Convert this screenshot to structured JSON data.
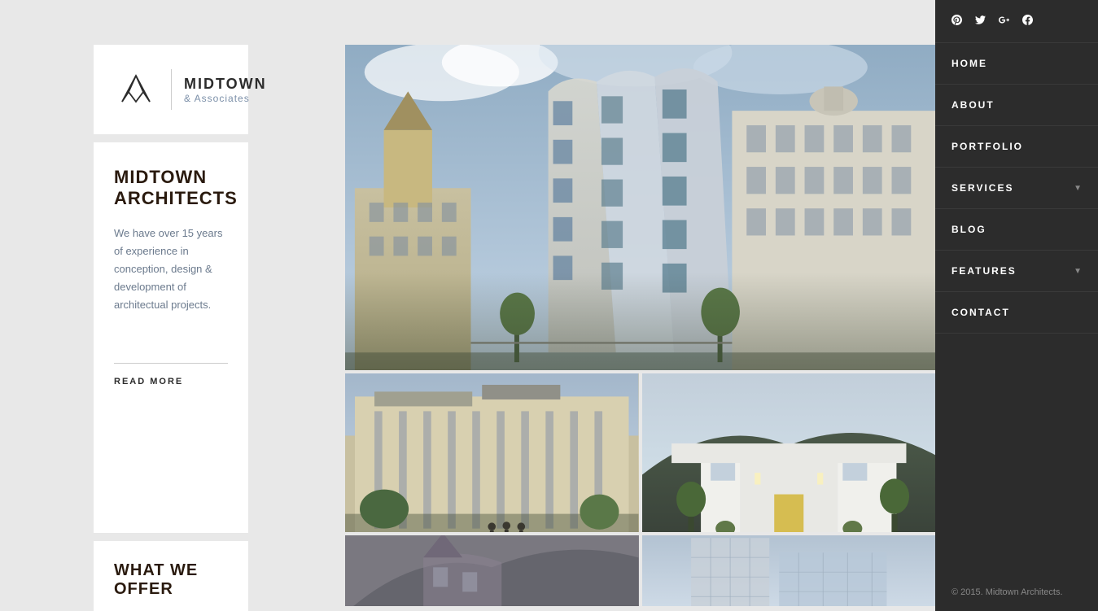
{
  "logo": {
    "title": "MIDTOWN",
    "subtitle": "& Associates"
  },
  "info": {
    "heading_line1": "MIDTOWN",
    "heading_line2": "ARCHITECTS",
    "description": "We have over 15 years of experience in conception, design & development of architectual projects.",
    "read_more_label": "READ MORE"
  },
  "what_we_offer": {
    "heading": "WHAT WE OFFER"
  },
  "nav": {
    "social_icons": [
      "pinterest-icon",
      "twitter-icon",
      "google-plus-icon",
      "facebook-icon"
    ],
    "social_symbols": [
      "℗",
      "𝕋",
      "𝔾",
      "𝕗"
    ],
    "items": [
      {
        "label": "HOME",
        "has_arrow": false
      },
      {
        "label": "ABOUT",
        "has_arrow": false
      },
      {
        "label": "PORTFOLIO",
        "has_arrow": false
      },
      {
        "label": "SERVICES",
        "has_arrow": true
      },
      {
        "label": "BLOG",
        "has_arrow": false
      },
      {
        "label": "FEATURES",
        "has_arrow": true
      },
      {
        "label": "CONTACT",
        "has_arrow": false
      }
    ],
    "copyright": "© 2015. Midtown Architects."
  }
}
